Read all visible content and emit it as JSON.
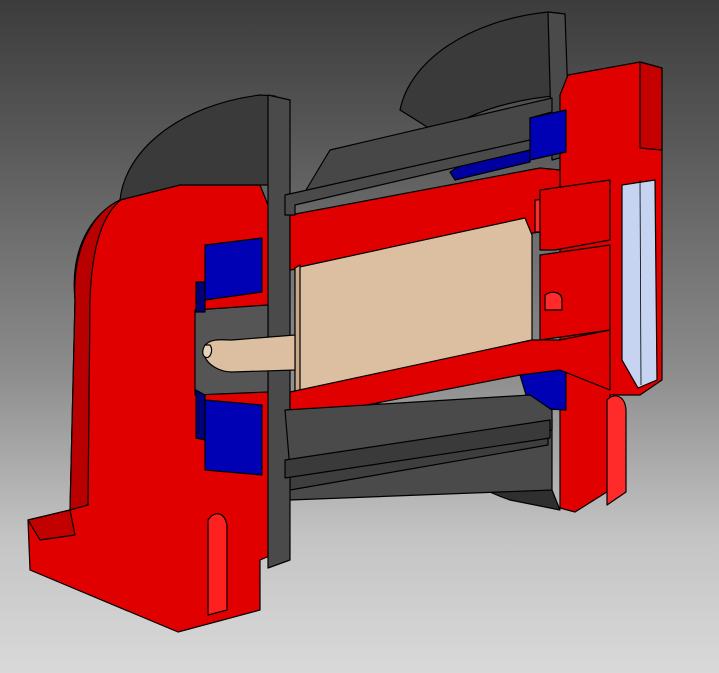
{
  "scene": {
    "type": "3d-cad-section-view",
    "background": {
      "top": "#3c3c3c",
      "bottom": "#d9d9d9"
    }
  },
  "parts": [
    {
      "id": "housing",
      "color": "#e00000",
      "shade": "#b80000"
    },
    {
      "id": "cap-shell",
      "color": "#4a4a4a",
      "shade": "#353535"
    },
    {
      "id": "seal",
      "color": "#0000b4",
      "shade": "#00007a"
    },
    {
      "id": "core",
      "color": "#dcbfa1",
      "shade": "#c9a887"
    },
    {
      "id": "window",
      "color": "#c6d4f2",
      "shade": "#aebde0"
    }
  ]
}
